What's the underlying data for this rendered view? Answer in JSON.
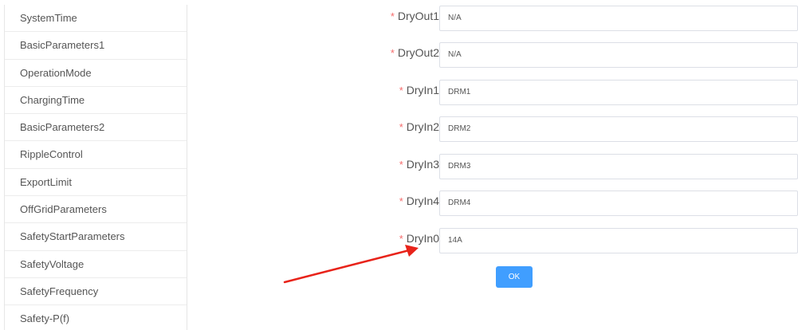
{
  "sidebar": {
    "items": [
      {
        "label": "SystemTime"
      },
      {
        "label": "BasicParameters1"
      },
      {
        "label": "OperationMode"
      },
      {
        "label": "ChargingTime"
      },
      {
        "label": "BasicParameters2"
      },
      {
        "label": "RippleControl"
      },
      {
        "label": "ExportLimit"
      },
      {
        "label": "OffGridParameters"
      },
      {
        "label": "SafetyStartParameters"
      },
      {
        "label": "SafetyVoltage"
      },
      {
        "label": "SafetyFrequency"
      },
      {
        "label": "Safety-P(f)"
      }
    ]
  },
  "form": {
    "required_mark": "*",
    "fields": [
      {
        "label": "DryOut1",
        "value": "N/A"
      },
      {
        "label": "DryOut2",
        "value": "N/A"
      },
      {
        "label": "DryIn1",
        "value": "DRM1"
      },
      {
        "label": "DryIn2",
        "value": "DRM2"
      },
      {
        "label": "DryIn3",
        "value": "DRM3"
      },
      {
        "label": "DryIn4",
        "value": "DRM4"
      },
      {
        "label": "DryIn0",
        "value": "14A"
      }
    ],
    "ok_label": "OK"
  },
  "colors": {
    "required": "#f56c6c",
    "primary_button": "#409eff",
    "annotation_arrow": "#e8231a"
  }
}
